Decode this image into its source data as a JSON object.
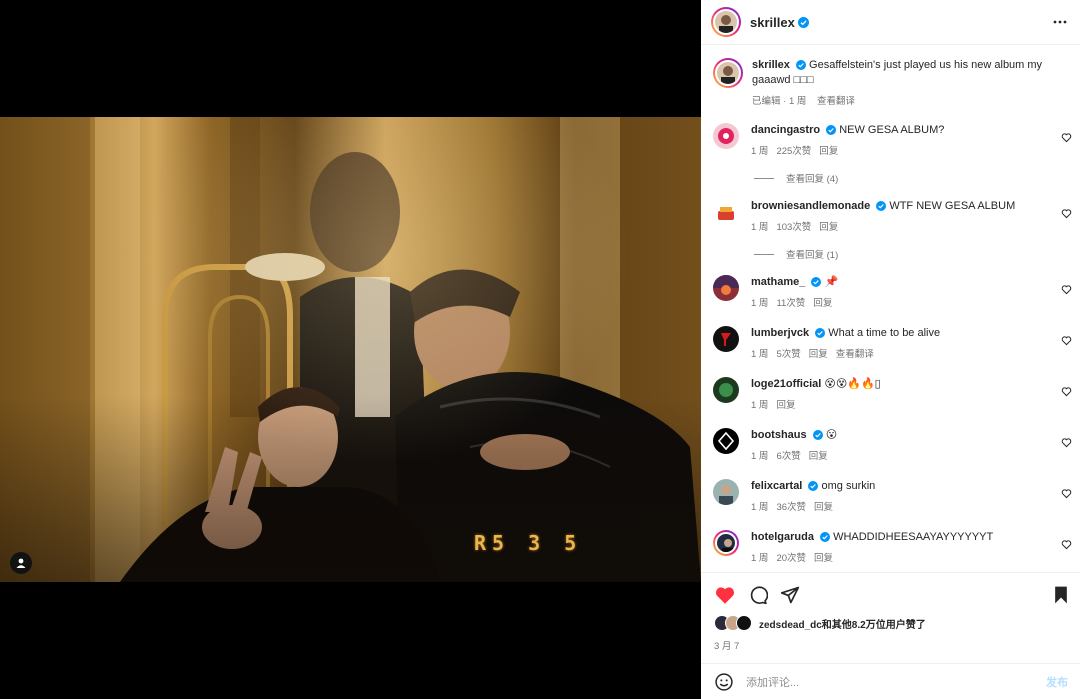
{
  "post": {
    "username": "skrillex",
    "caption": "Gesaffelstein's just played us his new album my gaaawd □□□",
    "caption_meta": {
      "edited": "已编辑 · 1 周",
      "translate": "查看翻译"
    },
    "photo_stamp": "R5 3 5"
  },
  "comments": [
    {
      "user": "dancingastro",
      "text": "NEW GESA ALBUM?",
      "time": "1 周",
      "likes": "225次赞",
      "reply": "回复",
      "view_replies": "查看回复 (4)",
      "avatar_color": "#e0245e",
      "avatar_icon": "disco-ball-icon"
    },
    {
      "user": "browniesandlemonade",
      "text": "WTF NEW GESA ALBUM",
      "time": "1 周",
      "likes": "103次赞",
      "reply": "回复",
      "view_replies": "查看回复 (1)",
      "avatar_color": "#d8402d",
      "avatar_icon": "cake-icon"
    },
    {
      "user": "mathame_",
      "text": "📌",
      "time": "1 周",
      "likes": "11次赞",
      "reply": "回复",
      "avatar_color": "#8a2f3a",
      "avatar_icon": "sunset-icon"
    },
    {
      "user": "lumberjvck",
      "text": "What a time to be alive",
      "time": "1 周",
      "likes": "5次赞",
      "reply": "回复",
      "translate": "查看翻译",
      "avatar_color": "#111111",
      "avatar_icon": "red-symbol-icon"
    },
    {
      "user": "loge21official",
      "text": "😵😵🔥🔥▯",
      "time": "1 周",
      "reply": "回复",
      "avatar_color": "#1d3a1f",
      "avatar_icon": "green-face-icon"
    },
    {
      "user": "bootshaus",
      "text": "😮",
      "time": "1 周",
      "likes": "6次赞",
      "reply": "回复",
      "avatar_color": "#000000",
      "avatar_icon": "diamond-logo-icon"
    },
    {
      "user": "felixcartal",
      "text": "omg surkin",
      "time": "1 周",
      "likes": "36次赞",
      "reply": "回复",
      "avatar_color": "#9bb3b0",
      "avatar_icon": "person-photo-icon"
    },
    {
      "user": "hotelgaruda",
      "text": "WHADDIDHEESAAYAYYYYYYT",
      "time": "1 周",
      "likes": "20次赞",
      "reply": "回复",
      "avatar_color": "#1e2c44",
      "avatar_icon": "person-photo-icon"
    }
  ],
  "likes_line": "zedsdead_dc和其他8.2万位用户赞了",
  "date": "3 月 7",
  "comment_input": {
    "placeholder": "添加评论...",
    "post_label": "发布"
  },
  "colors": {
    "verified": "#0095f6",
    "like_red": "#ff3040",
    "link_disabled": "#b2dffc"
  }
}
